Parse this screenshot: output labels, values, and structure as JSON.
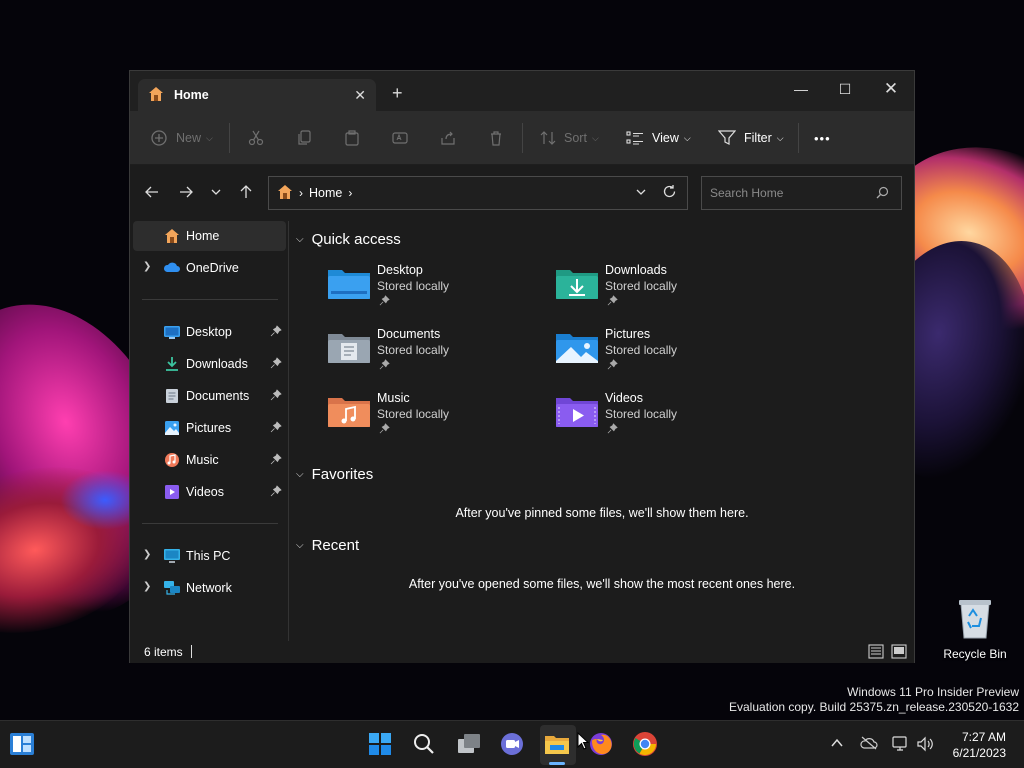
{
  "window": {
    "tab_title": "Home",
    "new_tab_symbol": "+",
    "controls": {
      "minimize": "—",
      "maximize": "☐",
      "close": "✕"
    }
  },
  "toolbar": {
    "new_label": "New",
    "sort_label": "Sort",
    "view_label": "View",
    "filter_label": "Filter",
    "more_label": "•••",
    "icons": [
      "plus-circle-icon",
      "cut-icon",
      "copy-icon",
      "paste-icon",
      "rename-icon",
      "share-icon",
      "delete-icon"
    ]
  },
  "navigation": {
    "address_crumb": "Home",
    "search_placeholder": "Search Home"
  },
  "sidebar": {
    "top": [
      {
        "label": "Home",
        "icon": "home-icon",
        "active": true
      },
      {
        "label": "OneDrive",
        "icon": "onedrive-cloud-icon",
        "expandable": true
      }
    ],
    "pinned": [
      {
        "label": "Desktop",
        "icon": "desktop-folder-icon"
      },
      {
        "label": "Downloads",
        "icon": "downloads-icon"
      },
      {
        "label": "Documents",
        "icon": "documents-icon"
      },
      {
        "label": "Pictures",
        "icon": "pictures-icon"
      },
      {
        "label": "Music",
        "icon": "music-icon"
      },
      {
        "label": "Videos",
        "icon": "videos-icon"
      }
    ],
    "bottom": [
      {
        "label": "This PC",
        "icon": "this-pc-icon",
        "expandable": true
      },
      {
        "label": "Network",
        "icon": "network-icon",
        "expandable": true
      }
    ]
  },
  "main": {
    "quick_access": {
      "heading": "Quick access",
      "items": [
        {
          "name": "Desktop",
          "sub": "Stored locally",
          "icon": "desktop-folder-icon"
        },
        {
          "name": "Downloads",
          "sub": "Stored locally",
          "icon": "downloads-folder-icon"
        },
        {
          "name": "Documents",
          "sub": "Stored locally",
          "icon": "documents-folder-icon"
        },
        {
          "name": "Pictures",
          "sub": "Stored locally",
          "icon": "pictures-folder-icon"
        },
        {
          "name": "Music",
          "sub": "Stored locally",
          "icon": "music-folder-icon"
        },
        {
          "name": "Videos",
          "sub": "Stored locally",
          "icon": "videos-folder-icon"
        }
      ]
    },
    "favorites": {
      "heading": "Favorites",
      "empty_text": "After you've pinned some files, we'll show them here."
    },
    "recent": {
      "heading": "Recent",
      "empty_text": "After you've opened some files, we'll show the most recent ones here."
    }
  },
  "statusbar": {
    "item_count": "6 items"
  },
  "desktop": {
    "recycle_bin_label": "Recycle Bin",
    "watermark_line1": "Windows 11 Pro Insider Preview",
    "watermark_line2": "Evaluation copy. Build 25375.zn_release.230520-1632"
  },
  "taskbar": {
    "icons": [
      "widgets-icon",
      "start-icon",
      "search-icon",
      "task-view-icon",
      "teams-chat-icon",
      "file-explorer-icon",
      "firefox-icon",
      "chrome-icon"
    ],
    "clock_time": "7:27 AM",
    "clock_date": "6/21/2023"
  },
  "colors": {
    "accent": "#6ab4ff",
    "folder_blue": "#3aa0f0",
    "folder_teal": "#2bb39a",
    "folder_gray": "#9aa6b2",
    "folder_orange": "#f08d5c",
    "folder_purple": "#8a5cf0"
  }
}
